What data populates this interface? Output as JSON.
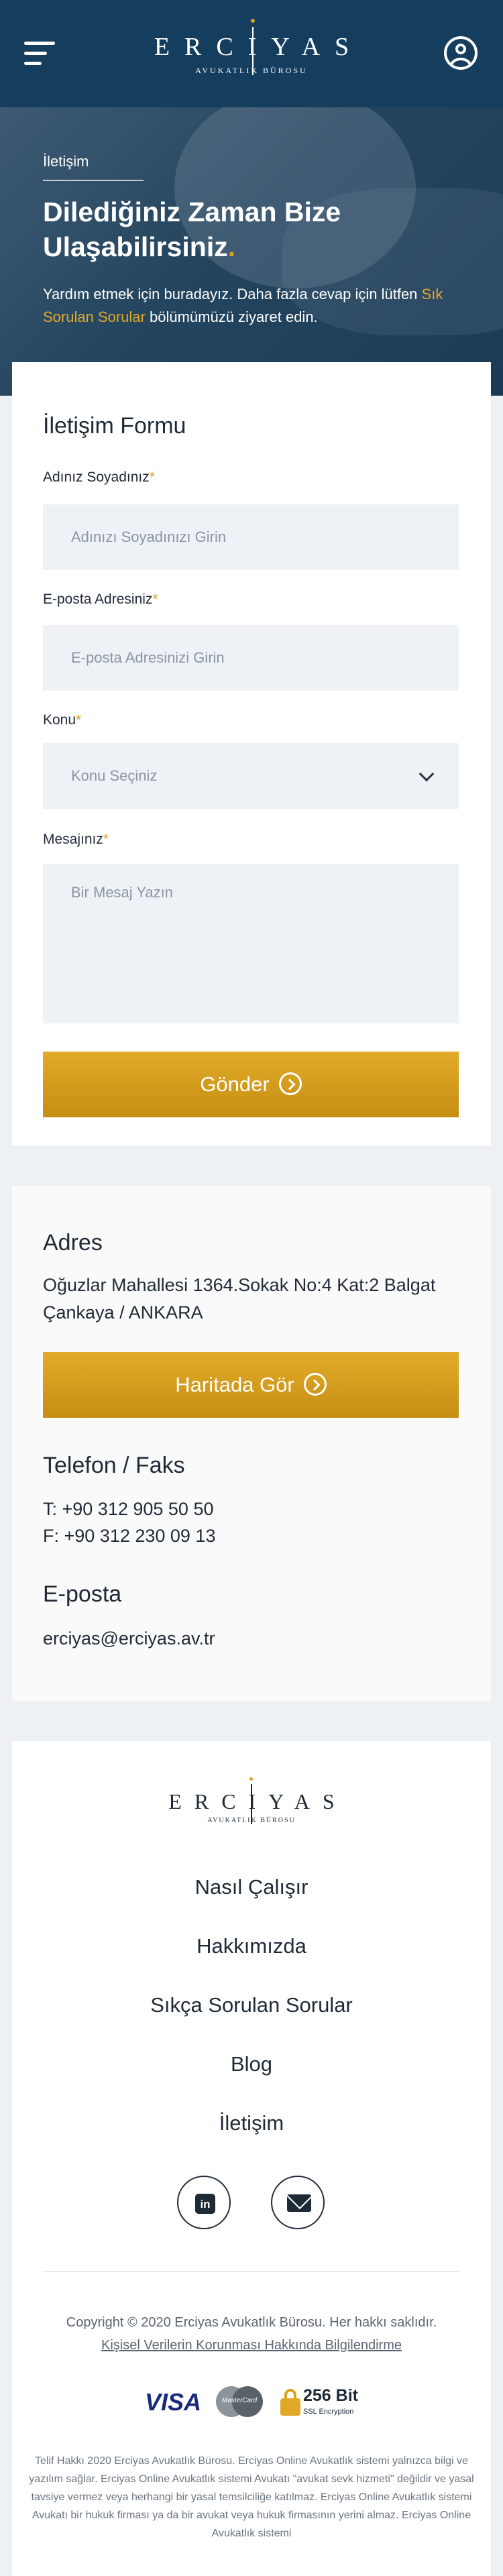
{
  "header": {
    "logo_name": "ERCIYAS",
    "logo_sub": "AVUKATLIK BÜROSU",
    "menu_icon": "hamburger-menu-icon",
    "user_icon": "user-account-icon"
  },
  "hero": {
    "breadcrumb": "İletişim",
    "title": "Dilediğiniz Zaman Bize Ulaşabilirsiniz",
    "title_dot": ".",
    "desc_before": "Yardım etmek için buradayız. Daha fazla cevap için lütfen ",
    "desc_link": "Sık Sorulan Sorular",
    "desc_after": " bölümümüzü ziyaret edin."
  },
  "form": {
    "title": "İletişim Formu",
    "name_label": "Adınız Soyadınız",
    "name_placeholder": "Adınızı Soyadınızı Girin",
    "email_label": "E-posta Adresiniz",
    "email_placeholder": "E-posta Adresinizi Girin",
    "subject_label": "Konu",
    "subject_value": "Konu Seçiniz",
    "message_label": "Mesajınız",
    "message_placeholder": "Bir Mesaj Yazın",
    "required_mark": "*",
    "submit_label": "Gönder"
  },
  "contact": {
    "address_title": "Adres",
    "address_text": "Oğuzlar Mahallesi 1364.Sokak No:4 Kat:2 Balgat Çankaya / ANKARA",
    "map_button": "Haritada Gör",
    "phone_title": "Telefon / Faks",
    "phone": "T: +90 312 905 50 50",
    "fax": "F: +90 312 230 09 13",
    "email_title": "E-posta",
    "email": "erciyas@erciyas.av.tr"
  },
  "footer": {
    "logo_name": "ERCIYAS",
    "logo_sub": "AVUKATLIK BÜROSU",
    "nav": [
      "Nasıl Çalışır",
      "Hakkımızda",
      "Sıkça Sorulan Sorular",
      "Blog",
      "İletişim"
    ],
    "linkedin_text": "in",
    "copyright": "Copyright © 2020 Erciyas Avukatlık Bürosu. Her hakkı saklıdır.",
    "kvkk_link": "Kişisel Verilerin Korunması Hakkında Bilgilendirme",
    "visa": "VISA",
    "mastercard": "MasterCard",
    "ssl_title": "256 Bit",
    "ssl_sub": "SSL Encryption",
    "legal": "Telif Hakkı 2020 Erciyas Avukatlık Bürosu. Erciyas Online Avukatlık sistemi yalnızca bilgi ve yazılım sağlar. Erciyas Online Avukatlık sistemi Avukatı \"avukat sevk hizmeti\" değildir ve yasal tavsiye vermez veya herhangi bir yasal temsilciliğe katılmaz. Erciyas Online Avukatlık sistemi Avukatı bir hukuk firması ya da bir avukat veya hukuk firmasının yerini almaz. Erciyas Online Avukatlık sistemi"
  },
  "colors": {
    "navy": "#153d5e",
    "gold": "#d9a21b",
    "page_bg": "#eef1f4"
  }
}
